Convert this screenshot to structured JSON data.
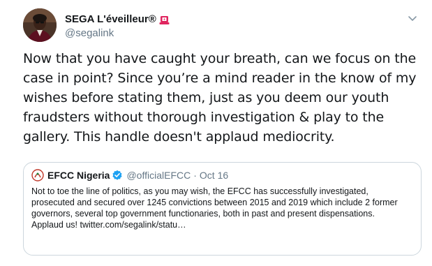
{
  "tweet": {
    "author_name": "SEGA L'éveilleur®",
    "author_handle": "@segalink",
    "badge_icon": "siren-icon",
    "text": "Now that you have caught your breath, can we focus on the case in point? Since you’re a mind reader in the know of my wishes before stating them, just as you deem our youth fraudsters without thorough investigation & play to the gallery. This handle doesn't applaud mediocrity."
  },
  "quoted_tweet": {
    "author_name": "EFCC Nigeria",
    "author_handle": "@officialEFCC",
    "separator": "·",
    "date": "Oct 16",
    "verified_icon": "verified-badge-icon",
    "text": "Not to toe the line of politics, as you may wish, the EFCC has successfully investigated, prosecuted and secured over 1245 convictions between 2015 and 2019 which include 2 former governors, several top government functionaries, both in past and present dispensations.\nApplaud us! twitter.com/segalink/statu…"
  },
  "colors": {
    "primary_text": "#14171a",
    "secondary_text": "#657786",
    "border": "#ccd6dd",
    "verified_blue": "#1da1f2",
    "siren_red": "#e0245e"
  }
}
